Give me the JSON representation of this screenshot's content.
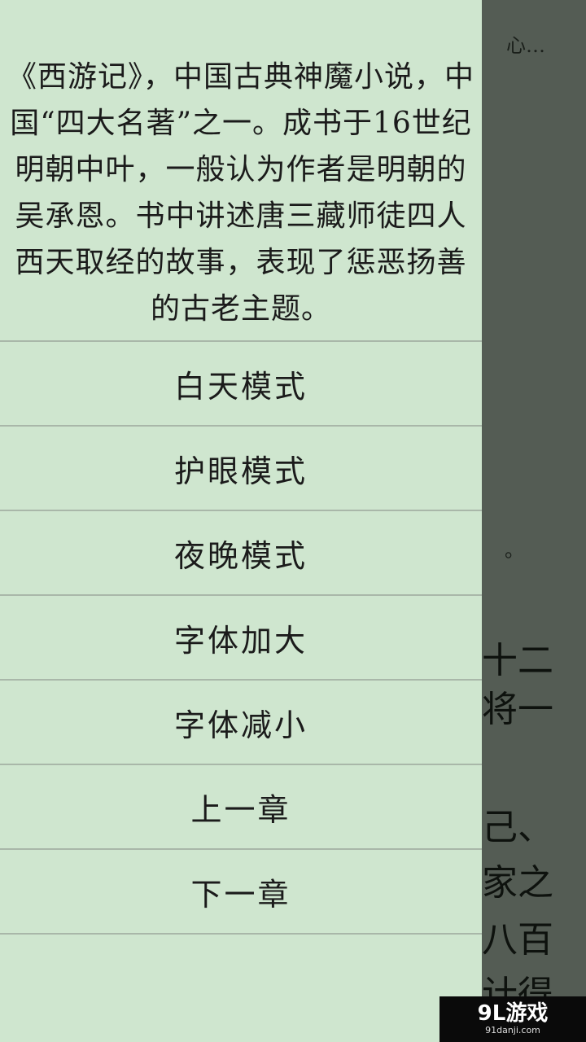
{
  "reader": {
    "top_fragment": "心…",
    "dot_fragment": "。",
    "line_fragments": [
      "十二",
      "将一",
      "己、",
      "家之",
      "八百",
      "计得"
    ]
  },
  "drawer": {
    "intro": "《西游记》，中国古典神魔小说，中国“四大名著”之一。成书于16世纪明朝中叶，一般认为作者是明朝的吴承恩。书中讲述唐三藏师徒四人西天取经的故事，表现了惩恶扬善的古老主题。",
    "menu": [
      {
        "label": "白天模式"
      },
      {
        "label": "护眼模式"
      },
      {
        "label": "夜晚模式"
      },
      {
        "label": "字体加大"
      },
      {
        "label": "字体减小"
      },
      {
        "label": "上一章"
      },
      {
        "label": "下一章"
      }
    ]
  },
  "watermark": {
    "logo": "9L游戏",
    "url": "91danji.com"
  },
  "colors": {
    "drawer_bg": "#cfe6cf",
    "overlay_bg": "#545c54",
    "divider": "#a9b7a9",
    "text": "#1b1b1b"
  }
}
